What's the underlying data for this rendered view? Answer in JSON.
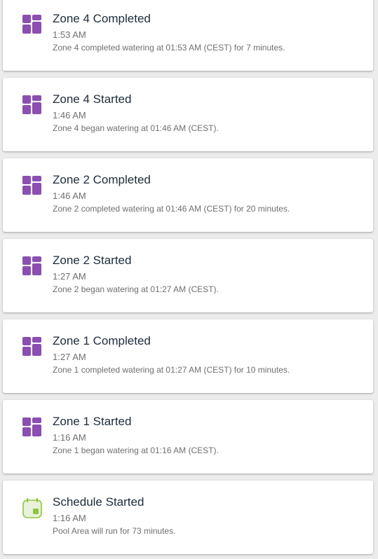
{
  "colors": {
    "zone_icon": "#8a4fb0",
    "schedule_icon_border": "#8dc63f",
    "schedule_icon_fill": "#e8f2da",
    "title_text": "#1d2b3a",
    "secondary_text": "#6f6f6f"
  },
  "events": [
    {
      "icon": "zone-grid-icon",
      "title": "Zone 4 Completed",
      "time": "1:53 AM",
      "description": "Zone 4 completed watering at 01:53 AM (CEST) for 7 minutes."
    },
    {
      "icon": "zone-grid-icon",
      "title": "Zone 4 Started",
      "time": "1:46 AM",
      "description": "Zone 4 began watering at 01:46 AM (CEST)."
    },
    {
      "icon": "zone-grid-icon",
      "title": "Zone 2 Completed",
      "time": "1:46 AM",
      "description": "Zone 2 completed watering at 01:46 AM (CEST) for 20 minutes."
    },
    {
      "icon": "zone-grid-icon",
      "title": "Zone 2 Started",
      "time": "1:27 AM",
      "description": "Zone 2 began watering at 01:27 AM (CEST)."
    },
    {
      "icon": "zone-grid-icon",
      "title": "Zone 1 Completed",
      "time": "1:27 AM",
      "description": "Zone 1 completed watering at 01:27 AM (CEST) for 10 minutes."
    },
    {
      "icon": "zone-grid-icon",
      "title": "Zone 1 Started",
      "time": "1:16 AM",
      "description": "Zone 1 began watering at 01:16 AM (CEST)."
    },
    {
      "icon": "calendar-icon",
      "title": "Schedule Started",
      "time": "1:16 AM",
      "description": "Pool Area will run for 73 minutes."
    }
  ]
}
